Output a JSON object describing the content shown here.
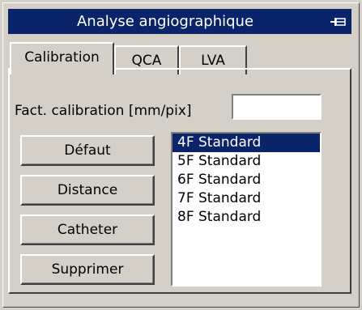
{
  "window": {
    "title": "Analyse angiographique",
    "pin_icon": "pin-icon"
  },
  "tabs": [
    {
      "label": "Calibration",
      "active": true
    },
    {
      "label": "QCA",
      "active": false
    },
    {
      "label": "LVA",
      "active": false
    }
  ],
  "calibration": {
    "factor_label": "Fact. calibration [mm/pix]",
    "factor_value": "",
    "buttons": {
      "default": "Défaut",
      "distance": "Distance",
      "catheter": "Catheter",
      "delete": "Supprimer"
    },
    "catheter_list": [
      {
        "label": "4F Standard",
        "selected": true
      },
      {
        "label": "5F Standard",
        "selected": false
      },
      {
        "label": "6F Standard",
        "selected": false
      },
      {
        "label": "7F Standard",
        "selected": false
      },
      {
        "label": "8F Standard",
        "selected": false
      }
    ]
  },
  "colors": {
    "titlebar": "#0a246a",
    "face": "#d4d0c8",
    "selection": "#0a246a"
  }
}
